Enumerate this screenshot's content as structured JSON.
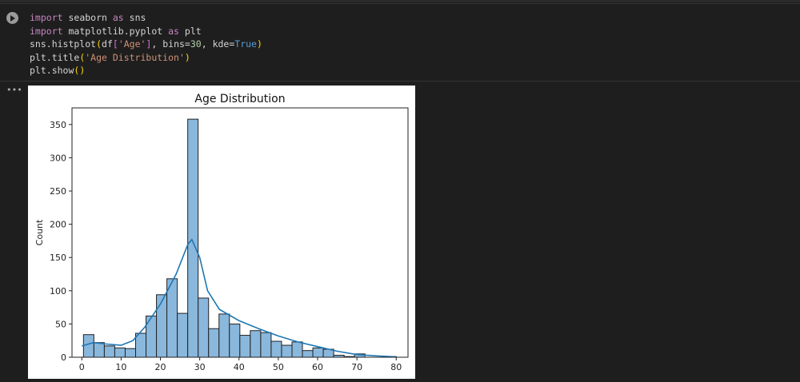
{
  "code_lines": [
    [
      [
        "import",
        "kw"
      ],
      [
        " seaborn ",
        ""
      ],
      [
        "as",
        "kw"
      ],
      [
        " sns",
        ""
      ]
    ],
    [
      [
        "import",
        "kw"
      ],
      [
        " matplotlib.pyplot ",
        ""
      ],
      [
        "as",
        "kw"
      ],
      [
        " plt",
        ""
      ]
    ],
    [
      [
        "sns.histplot",
        ""
      ],
      [
        "(",
        "br"
      ],
      [
        "df",
        ""
      ],
      [
        "[",
        "br2"
      ],
      [
        "'Age'",
        "str"
      ],
      [
        "]",
        "br2"
      ],
      [
        ", bins=",
        ""
      ],
      [
        "30",
        "num"
      ],
      [
        ", kde=",
        ""
      ],
      [
        "True",
        "bool"
      ],
      [
        ")",
        "br"
      ]
    ],
    [
      [
        "plt.title",
        ""
      ],
      [
        "(",
        "br"
      ],
      [
        "'Age Distribution'",
        "str"
      ],
      [
        ")",
        "br"
      ]
    ],
    [
      [
        "plt.show",
        ""
      ],
      [
        "()",
        "br"
      ]
    ]
  ],
  "output_menu": "•••",
  "chart_data": {
    "type": "bar",
    "title": "Age Distribution",
    "xlabel": "",
    "ylabel": "Count",
    "xlim": [
      -2.5,
      83
    ],
    "ylim": [
      0,
      375
    ],
    "xticks": [
      0,
      10,
      20,
      30,
      40,
      50,
      60,
      70,
      80
    ],
    "yticks": [
      0,
      50,
      100,
      150,
      200,
      250,
      300,
      350
    ],
    "bin_start": 0.42,
    "bin_width": 2.653,
    "values": [
      34,
      22,
      17,
      14,
      13,
      36,
      62,
      94,
      118,
      66,
      358,
      89,
      43,
      65,
      50,
      33,
      40,
      37,
      24,
      18,
      23,
      10,
      14,
      12,
      3,
      1,
      5,
      0,
      0,
      1
    ],
    "kde": {
      "x": [
        0,
        3,
        6,
        10,
        13,
        16,
        20,
        24,
        27,
        28,
        30,
        32,
        35,
        40,
        45,
        50,
        55,
        60,
        65,
        70,
        75,
        80
      ],
      "y": [
        17,
        22,
        20,
        18,
        25,
        45,
        80,
        125,
        170,
        177,
        150,
        100,
        72,
        55,
        43,
        32,
        23,
        16,
        9,
        4,
        2,
        0.5
      ]
    },
    "bar_color": "#8ab7dc",
    "line_color": "#1f77b4"
  }
}
